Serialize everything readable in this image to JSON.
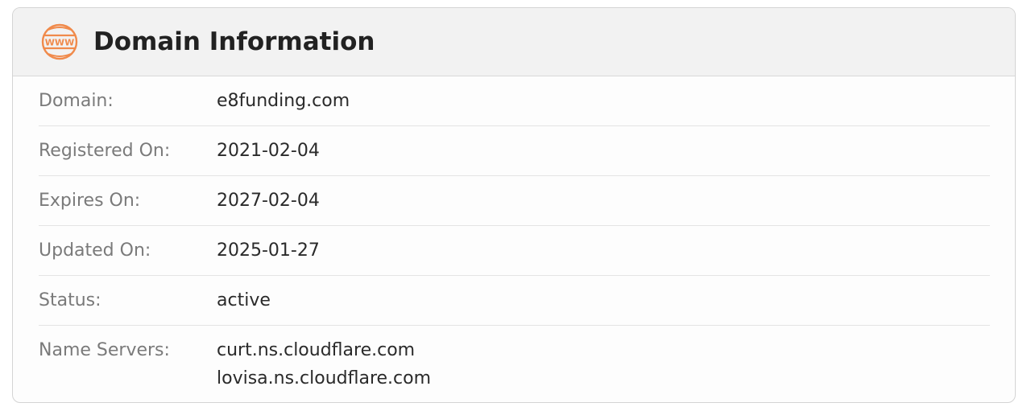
{
  "card": {
    "title": "Domain Information",
    "icon": "www-icon",
    "accent_color": "#f08a4b"
  },
  "rows": {
    "domain": {
      "label": "Domain:",
      "value": "e8funding.com"
    },
    "registered": {
      "label": "Registered On:",
      "value": "2021-02-04"
    },
    "expires": {
      "label": "Expires On:",
      "value": "2027-02-04"
    },
    "updated": {
      "label": "Updated On:",
      "value": "2025-01-27"
    },
    "status": {
      "label": "Status:",
      "value": "active"
    },
    "name_servers": {
      "label": "Name Servers:",
      "values": [
        "curt.ns.cloudflare.com",
        "lovisa.ns.cloudflare.com"
      ]
    }
  }
}
